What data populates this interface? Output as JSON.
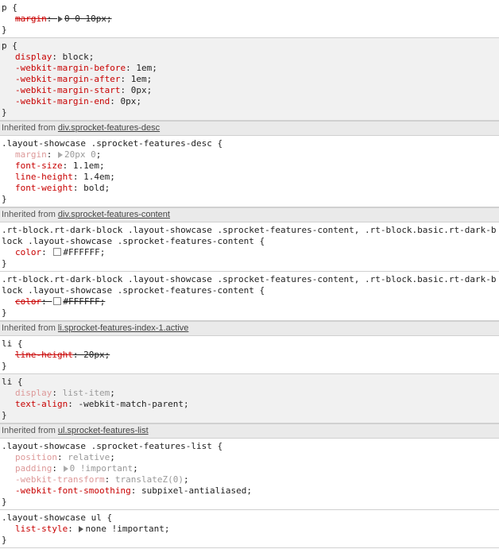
{
  "inherited_prefix": "Inherited from",
  "blocks": [
    {
      "type": "rule",
      "ua": false,
      "selector": "p {",
      "decls": [
        {
          "prop": "margin",
          "val": "0 0 10px",
          "state": "overridden",
          "tri": true
        }
      ]
    },
    {
      "type": "rule",
      "ua": true,
      "selector": "p {",
      "decls": [
        {
          "prop": "display",
          "val": "block",
          "state": "normal"
        },
        {
          "prop": "-webkit-margin-before",
          "val": "1em",
          "state": "normal"
        },
        {
          "prop": "-webkit-margin-after",
          "val": "1em",
          "state": "normal"
        },
        {
          "prop": "-webkit-margin-start",
          "val": "0px",
          "state": "normal"
        },
        {
          "prop": "-webkit-margin-end",
          "val": "0px",
          "state": "normal"
        }
      ]
    },
    {
      "type": "inherited",
      "link": "div.sprocket-features-desc"
    },
    {
      "type": "rule",
      "ua": false,
      "selector": ".layout-showcase .sprocket-features-desc {",
      "decls": [
        {
          "prop": "margin",
          "val": "20px 0",
          "state": "inactive",
          "tri": true
        },
        {
          "prop": "font-size",
          "val": "1.1em",
          "state": "normal"
        },
        {
          "prop": "line-height",
          "val": "1.4em",
          "state": "normal"
        },
        {
          "prop": "font-weight",
          "val": "bold",
          "state": "normal"
        }
      ]
    },
    {
      "type": "inherited",
      "link": "div.sprocket-features-content"
    },
    {
      "type": "rule",
      "ua": false,
      "selector": ".rt-block.rt-dark-block .layout-showcase .sprocket-features-content, .rt-block.basic.rt-dark-block .layout-showcase .sprocket-features-content {",
      "decls": [
        {
          "prop": "color",
          "val": "#FFFFFF",
          "state": "normal",
          "swatch": "#FFFFFF"
        }
      ]
    },
    {
      "type": "rule",
      "ua": false,
      "selector": ".rt-block.rt-dark-block .layout-showcase .sprocket-features-content, .rt-block.basic.rt-dark-block .layout-showcase .sprocket-features-content {",
      "decls": [
        {
          "prop": "color",
          "val": "#FFFFFF",
          "state": "overridden",
          "swatch": "#FFFFFF"
        }
      ]
    },
    {
      "type": "inherited",
      "link": "li.sprocket-features-index-1.active"
    },
    {
      "type": "rule",
      "ua": false,
      "selector": "li {",
      "decls": [
        {
          "prop": "line-height",
          "val": "20px",
          "state": "overridden"
        }
      ]
    },
    {
      "type": "rule",
      "ua": true,
      "selector": "li {",
      "decls": [
        {
          "prop": "display",
          "val": "list-item",
          "state": "inactive"
        },
        {
          "prop": "text-align",
          "val": "-webkit-match-parent",
          "state": "normal"
        }
      ]
    },
    {
      "type": "inherited",
      "link": "ul.sprocket-features-list"
    },
    {
      "type": "rule",
      "ua": false,
      "selector": ".layout-showcase .sprocket-features-list {",
      "decls": [
        {
          "prop": "position",
          "val": "relative",
          "state": "inactive"
        },
        {
          "prop": "padding",
          "val": "0 !important",
          "state": "inactive",
          "tri": true
        },
        {
          "prop": "-webkit-transform",
          "val": "translateZ(0)",
          "state": "inactive"
        },
        {
          "prop": "-webkit-font-smoothing",
          "val": "subpixel-antialiased",
          "state": "normal"
        }
      ]
    },
    {
      "type": "rule",
      "ua": false,
      "selector": ".layout-showcase ul {",
      "decls": [
        {
          "prop": "list-style",
          "val": "none !important",
          "state": "normal",
          "tri": true
        }
      ]
    }
  ]
}
